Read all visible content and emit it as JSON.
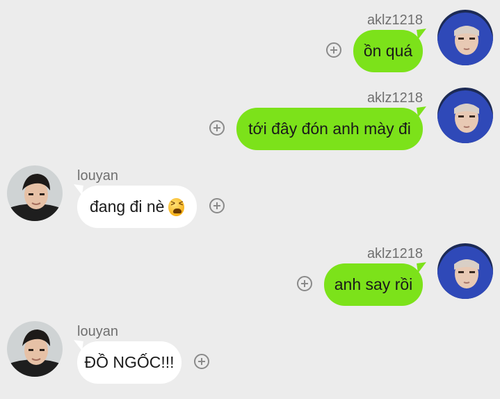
{
  "messages": [
    {
      "direction": "out",
      "sender": "aklz1218",
      "text": "ồn quá"
    },
    {
      "direction": "out",
      "sender": "aklz1218",
      "text": "tới đây đón anh mày đi"
    },
    {
      "direction": "in",
      "sender": "louyan",
      "text": "đang đi nè",
      "emoji": "tired-face-emoji"
    },
    {
      "direction": "out",
      "sender": "aklz1218",
      "text": "anh say rồi"
    },
    {
      "direction": "in",
      "sender": "louyan",
      "text": "ĐỒ NGỐC!!!"
    }
  ],
  "colors": {
    "background": "#ececec",
    "outgoing_bubble": "#7ce21a",
    "incoming_bubble": "#ffffff",
    "sender_text": "#6f6f6f"
  },
  "icons": {
    "add": "plus-circle-icon",
    "avatar_out": "avatar-aklz1218",
    "avatar_in": "avatar-louyan"
  }
}
